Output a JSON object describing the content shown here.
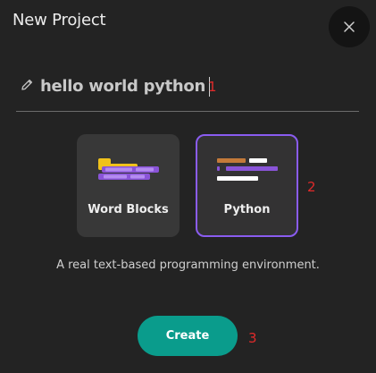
{
  "dialog": {
    "title": "New Project",
    "close_icon": "close-icon"
  },
  "name_field": {
    "value": "hello world python",
    "icon": "pencil-icon"
  },
  "options": [
    {
      "label": "Word Blocks",
      "icon": "blocks-icon",
      "selected": false
    },
    {
      "label": "Python",
      "icon": "code-lines-icon",
      "selected": true
    }
  ],
  "description": "A real text-based programming environment.",
  "create_label": "Create",
  "markers": [
    "1",
    "2",
    "3"
  ],
  "colors": {
    "background": "#232323",
    "accent_teal": "#0a9c8c",
    "selected_border": "#8a5cf0",
    "marker_red": "#e02a2a"
  }
}
